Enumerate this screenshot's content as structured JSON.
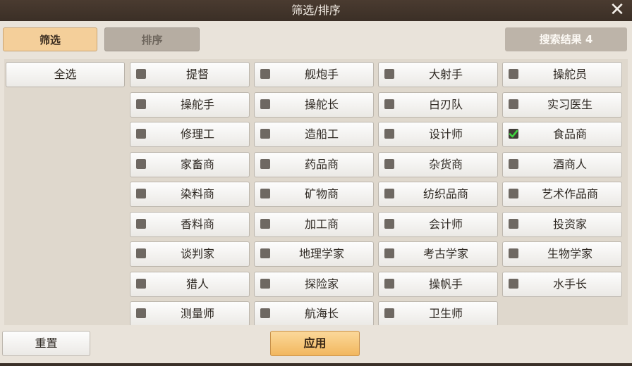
{
  "dialog": {
    "title": "筛选/排序"
  },
  "tabs": {
    "filter": "筛选",
    "sort": "排序"
  },
  "result_label": "搜索结果 4",
  "select_all": "全选",
  "items": [
    {
      "label": "提督",
      "checked": false
    },
    {
      "label": "舰炮手",
      "checked": false
    },
    {
      "label": "大射手",
      "checked": false
    },
    {
      "label": "操舵员",
      "checked": false
    },
    {
      "label": "操舵手",
      "checked": false
    },
    {
      "label": "操舵长",
      "checked": false
    },
    {
      "label": "白刃队",
      "checked": false
    },
    {
      "label": "实习医生",
      "checked": false
    },
    {
      "label": "修理工",
      "checked": false
    },
    {
      "label": "造船工",
      "checked": false
    },
    {
      "label": "设计师",
      "checked": false
    },
    {
      "label": "食品商",
      "checked": true
    },
    {
      "label": "家畜商",
      "checked": false
    },
    {
      "label": "药品商",
      "checked": false
    },
    {
      "label": "杂货商",
      "checked": false
    },
    {
      "label": "酒商人",
      "checked": false
    },
    {
      "label": "染料商",
      "checked": false
    },
    {
      "label": "矿物商",
      "checked": false
    },
    {
      "label": "纺织品商",
      "checked": false
    },
    {
      "label": "艺术作品商",
      "checked": false
    },
    {
      "label": "香料商",
      "checked": false
    },
    {
      "label": "加工商",
      "checked": false
    },
    {
      "label": "会计师",
      "checked": false
    },
    {
      "label": "投资家",
      "checked": false
    },
    {
      "label": "谈判家",
      "checked": false
    },
    {
      "label": "地理学家",
      "checked": false
    },
    {
      "label": "考古学家",
      "checked": false
    },
    {
      "label": "生物学家",
      "checked": false
    },
    {
      "label": "猎人",
      "checked": false
    },
    {
      "label": "探险家",
      "checked": false
    },
    {
      "label": "操帆手",
      "checked": false
    },
    {
      "label": "水手长",
      "checked": false
    },
    {
      "label": "测量师",
      "checked": false
    },
    {
      "label": "航海长",
      "checked": false
    },
    {
      "label": "卫生师",
      "checked": false
    }
  ],
  "buttons": {
    "reset": "重置",
    "apply": "应用"
  }
}
